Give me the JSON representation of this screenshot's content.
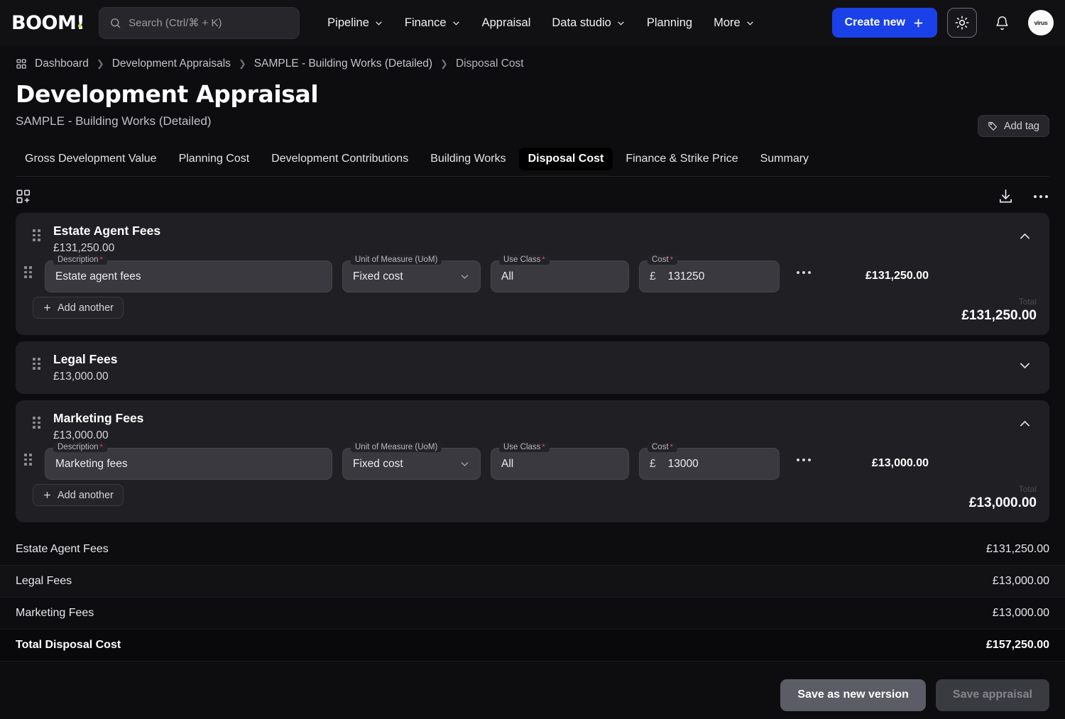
{
  "header": {
    "logo": "BOOM!",
    "search": {
      "placeholder": "Search (Ctrl/⌘ + K)"
    },
    "nav": [
      {
        "label": "Pipeline",
        "caret": true
      },
      {
        "label": "Finance",
        "caret": true
      },
      {
        "label": "Appraisal",
        "caret": false
      },
      {
        "label": "Data studio",
        "caret": true
      },
      {
        "label": "Planning",
        "caret": false
      },
      {
        "label": "More",
        "caret": true
      }
    ],
    "create_label": "Create new",
    "avatar_text": "virus",
    "accent_color": "#1a41e8"
  },
  "breadcrumb": [
    "Dashboard",
    "Development Appraisals",
    "SAMPLE - Building Works (Detailed)",
    "Disposal Cost"
  ],
  "page": {
    "title": "Development Appraisal",
    "subtitle": "SAMPLE - Building Works (Detailed)",
    "add_tag_label": "Add tag"
  },
  "tabs": [
    {
      "label": "Gross Development Value",
      "active": false
    },
    {
      "label": "Planning Cost",
      "active": false
    },
    {
      "label": "Development Contributions",
      "active": false
    },
    {
      "label": "Building Works",
      "active": false
    },
    {
      "label": "Disposal Cost",
      "active": true
    },
    {
      "label": "Finance & Strike Price",
      "active": false
    },
    {
      "label": "Summary",
      "active": false
    }
  ],
  "labels": {
    "description": "Description",
    "uom": "Unit of Measure (UoM)",
    "use_class": "Use Class",
    "cost": "Cost",
    "currency": "£",
    "total": "Total",
    "add_another": "Add another"
  },
  "cards": [
    {
      "title": "Estate Agent Fees",
      "amount": "£131,250.00",
      "expanded": true,
      "row": {
        "description": "Estate agent fees",
        "uom": "Fixed cost",
        "use_class": "All",
        "cost": "131250",
        "line_total": "£131,250.00"
      },
      "card_total": "£131,250.00"
    },
    {
      "title": "Legal Fees",
      "amount": "£13,000.00",
      "expanded": false
    },
    {
      "title": "Marketing Fees",
      "amount": "£13,000.00",
      "expanded": true,
      "row": {
        "description": "Marketing fees",
        "uom": "Fixed cost",
        "use_class": "All",
        "cost": "13000",
        "line_total": "£13,000.00"
      },
      "card_total": "£13,000.00"
    }
  ],
  "summary": [
    {
      "label": "Estate Agent Fees",
      "value": "£131,250.00"
    },
    {
      "label": "Legal Fees",
      "value": "£13,000.00"
    },
    {
      "label": "Marketing Fees",
      "value": "£13,000.00"
    },
    {
      "label": "Total Disposal Cost",
      "value": "£157,250.00"
    }
  ],
  "footer": {
    "save_version_label": "Save as new version",
    "save_appraisal_label": "Save appraisal"
  }
}
